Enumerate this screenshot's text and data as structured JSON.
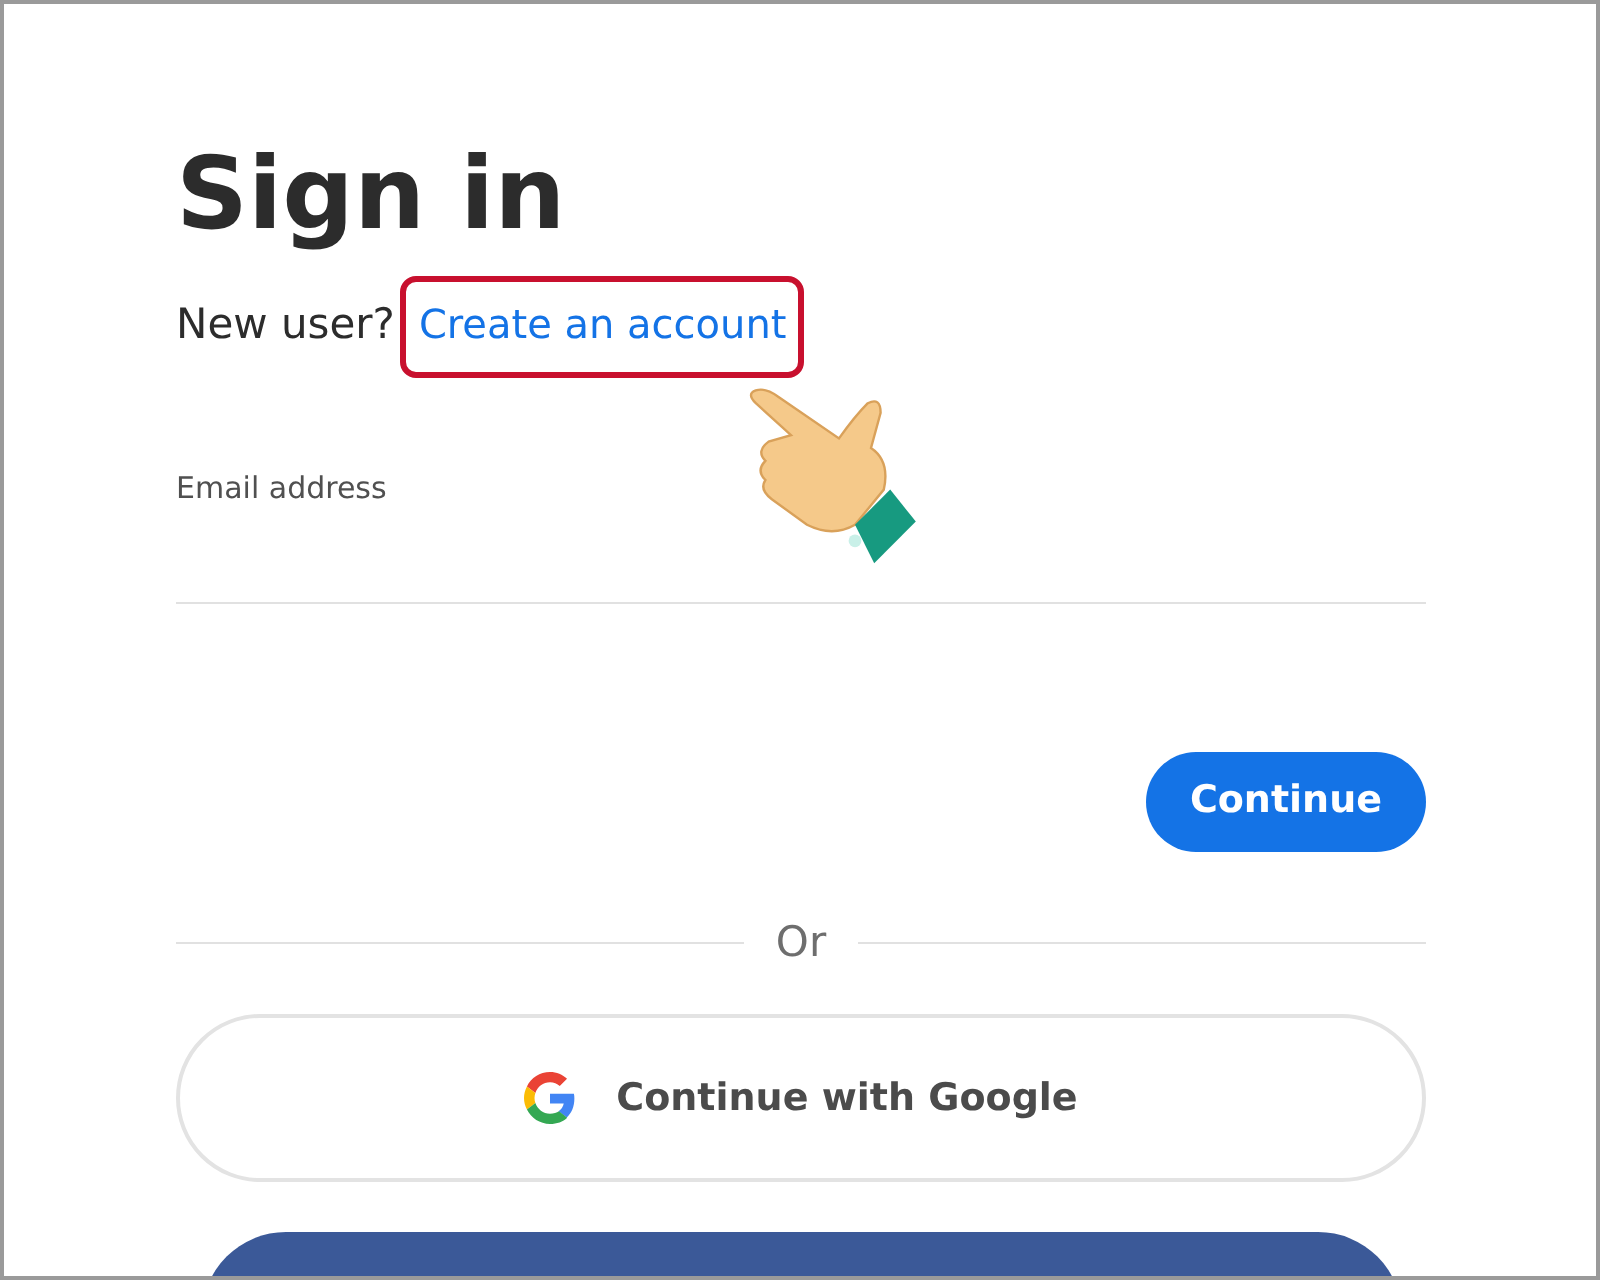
{
  "title": "Sign in",
  "new_user": {
    "prompt": "New user?",
    "link": "Create an account"
  },
  "email": {
    "label": "Email address"
  },
  "continue_button": "Continue",
  "divider": "Or",
  "social_buttons": [
    {
      "kind": "google",
      "label": "Continue with Google"
    },
    {
      "kind": "facebook"
    }
  ]
}
